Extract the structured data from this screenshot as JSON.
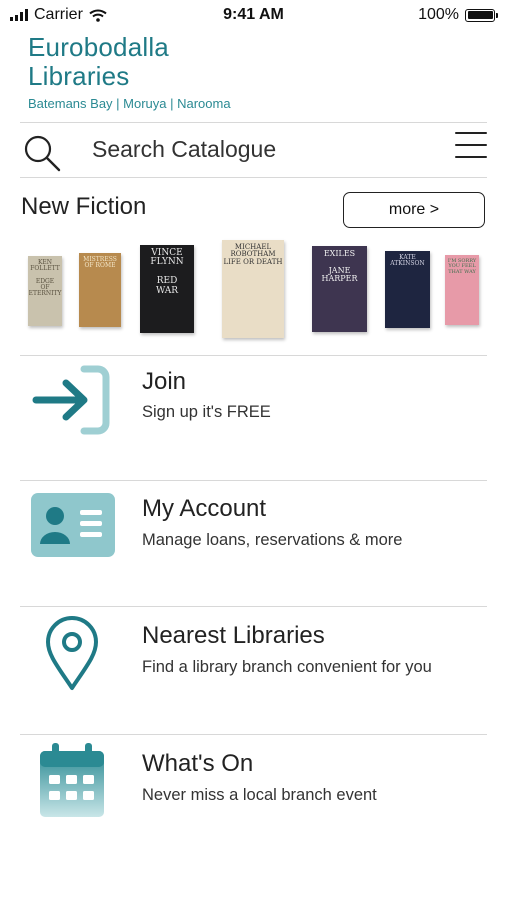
{
  "status_bar": {
    "carrier": "Carrier",
    "time": "9:41 AM",
    "battery": "100%"
  },
  "brand": {
    "name_line1": "Eurobodalla",
    "name_line2": "Libraries",
    "branches": "Batemans Bay | Moruya | Narooma"
  },
  "search": {
    "placeholder": "Search Catalogue"
  },
  "new_fiction": {
    "title": "New Fiction",
    "more_label": "more >",
    "books": [
      {
        "lines": [
          "KEN",
          "FOLLETT",
          "",
          "EDGE",
          "OF",
          "ETERNITY"
        ],
        "bg": "#c9c2ad",
        "fg": "#5a5240"
      },
      {
        "lines": [
          "MISTRESS",
          "OF ROME"
        ],
        "bg": "#b78a4e",
        "fg": "#f3e6c8"
      },
      {
        "lines": [
          "VINCE",
          "FLYNN",
          "",
          "RED",
          "WAR"
        ],
        "bg": "#1c1c1e",
        "fg": "#e8e8e8"
      },
      {
        "lines": [
          "MICHAEL",
          "ROBOTHAM",
          "LIFE OR DEATH"
        ],
        "bg": "#e9ddc6",
        "fg": "#333333"
      },
      {
        "lines": [
          "EXILES",
          "",
          "JANE",
          "HARPER"
        ],
        "bg": "#3e3550",
        "fg": "#f2f2f2"
      },
      {
        "lines": [
          "KATE",
          "ATKINSON"
        ],
        "bg": "#1e2540",
        "fg": "#d8d8e8"
      },
      {
        "lines": [
          "I'M SORRY",
          "YOU FEEL",
          "THAT WAY"
        ],
        "bg": "#e79aa8",
        "fg": "#3b6d4c"
      }
    ]
  },
  "menu": [
    {
      "key": "join",
      "title": "Join",
      "desc": "Sign up it's FREE",
      "icon": "sign-in-icon"
    },
    {
      "key": "account",
      "title": "My Account",
      "desc": "Manage loans, reservations & more",
      "icon": "id-card-icon"
    },
    {
      "key": "nearest",
      "title": "Nearest Libraries",
      "desc": "Find a library branch convenient for you",
      "icon": "location-pin-icon"
    },
    {
      "key": "whatson",
      "title": "What's On",
      "desc": "Never miss a local branch event",
      "icon": "calendar-icon"
    }
  ],
  "colors": {
    "brand": "#1f7a86",
    "icon_teal": "#2b8a93",
    "icon_light": "#9fcfd3"
  }
}
